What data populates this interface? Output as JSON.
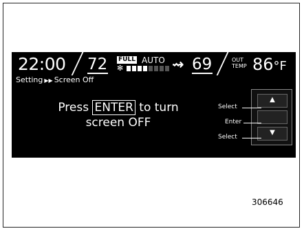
{
  "status_bar": {
    "clock": "22:00",
    "temp_left": "72",
    "fan_mode_badge": "FULL",
    "fan_mode_label": "AUTO",
    "fan_level": 0.5,
    "temp_right": "69",
    "outside_label_line1": "OUT",
    "outside_label_line2": "TEMP",
    "outside_temp": "86",
    "outside_unit": "°F",
    "airflow_icon": "airflow-icon"
  },
  "breadcrumb": {
    "parent": "Setting",
    "current": "Screen Off"
  },
  "message": {
    "before": "Press",
    "key": "ENTER",
    "after": "to turn",
    "line2": "screen OFF"
  },
  "controller": {
    "select_up_label": "Select",
    "enter_label": "Enter",
    "select_down_label": "Select"
  },
  "figure_id": "306646"
}
